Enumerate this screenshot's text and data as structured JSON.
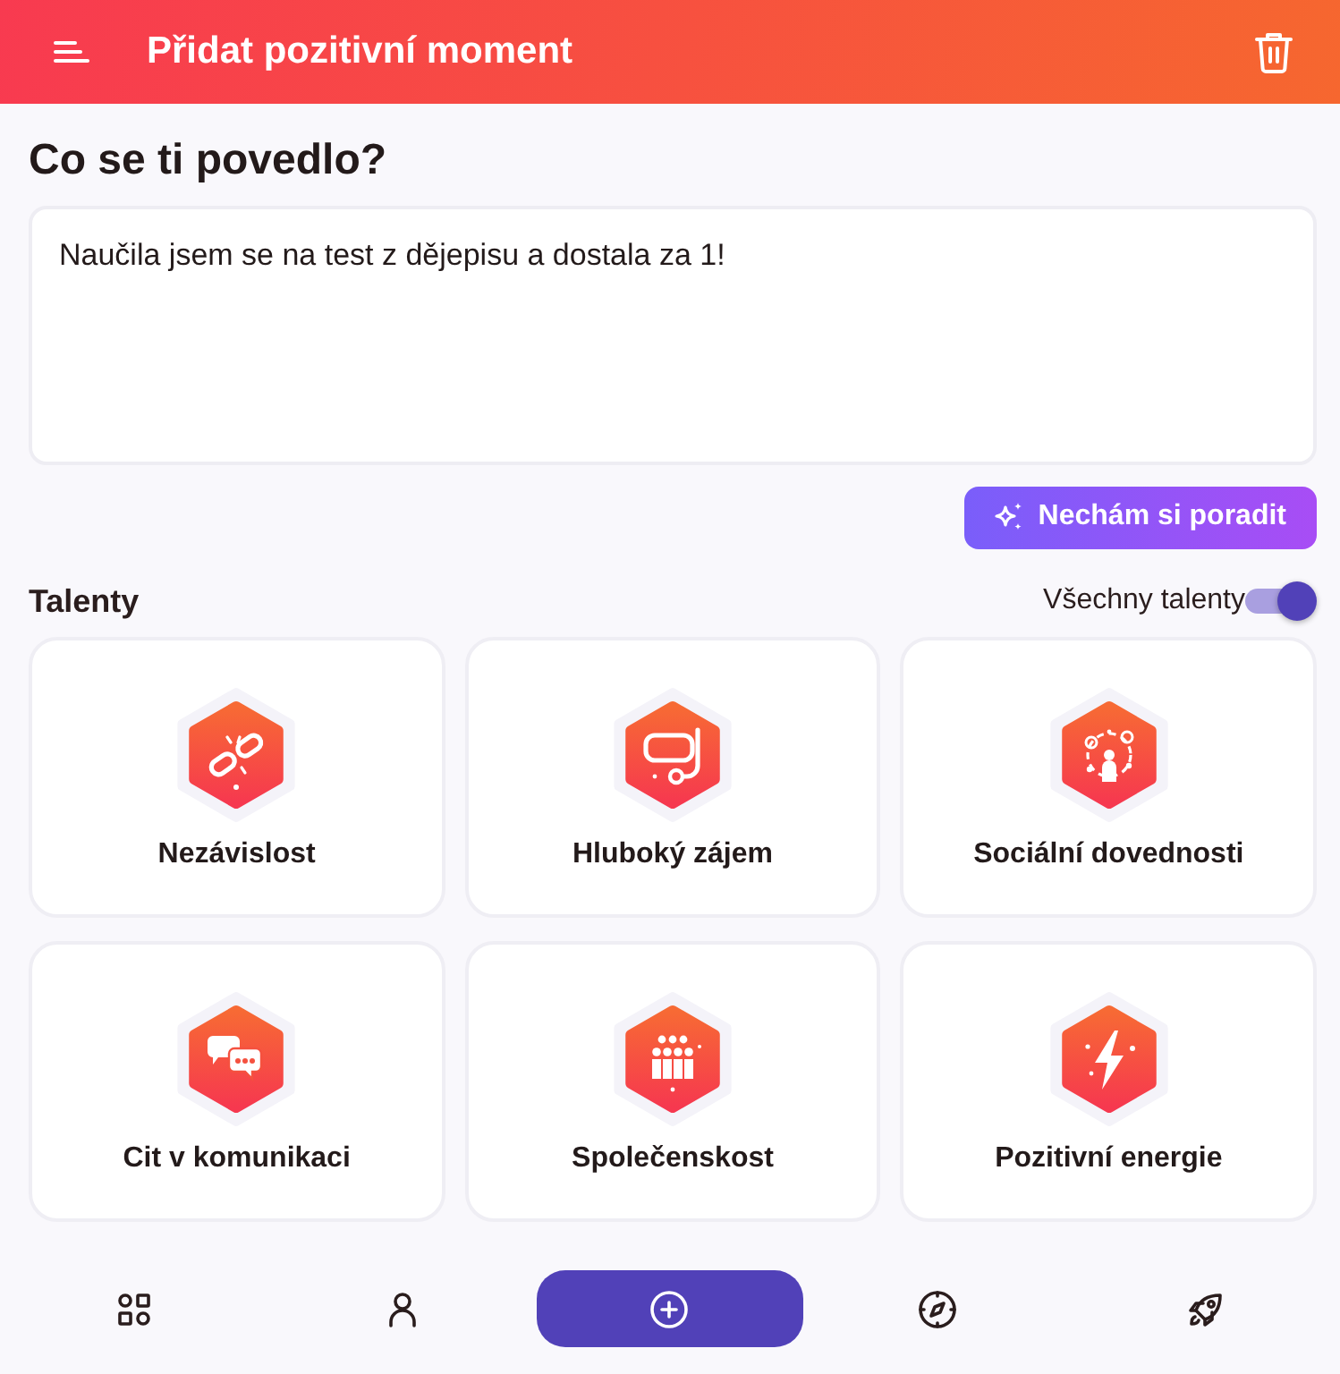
{
  "header": {
    "title": "Přidat pozitivní moment"
  },
  "question": {
    "heading": "Co se ti povedlo?",
    "value": "Naučila jsem se na test z dějepisu a dostala za 1!"
  },
  "advice_button": {
    "label": "Nechám si poradit"
  },
  "talents": {
    "heading": "Talenty",
    "filter_label": "Všechny talenty",
    "filter_on": true,
    "items": [
      {
        "name": "Nezávislost",
        "selected": false
      },
      {
        "name": "Hluboký zájem",
        "selected": false
      },
      {
        "name": "Sociální dovednosti",
        "selected": false
      },
      {
        "name": "Cit v komunikaci",
        "selected": false
      },
      {
        "name": "Společenskost",
        "selected": false
      },
      {
        "name": "Pozitivní energie",
        "selected": false
      }
    ]
  },
  "nav": {
    "items": [
      {
        "selected": false
      },
      {
        "selected": false
      },
      {
        "selected": true
      },
      {
        "selected": false
      },
      {
        "selected": false
      }
    ]
  }
}
